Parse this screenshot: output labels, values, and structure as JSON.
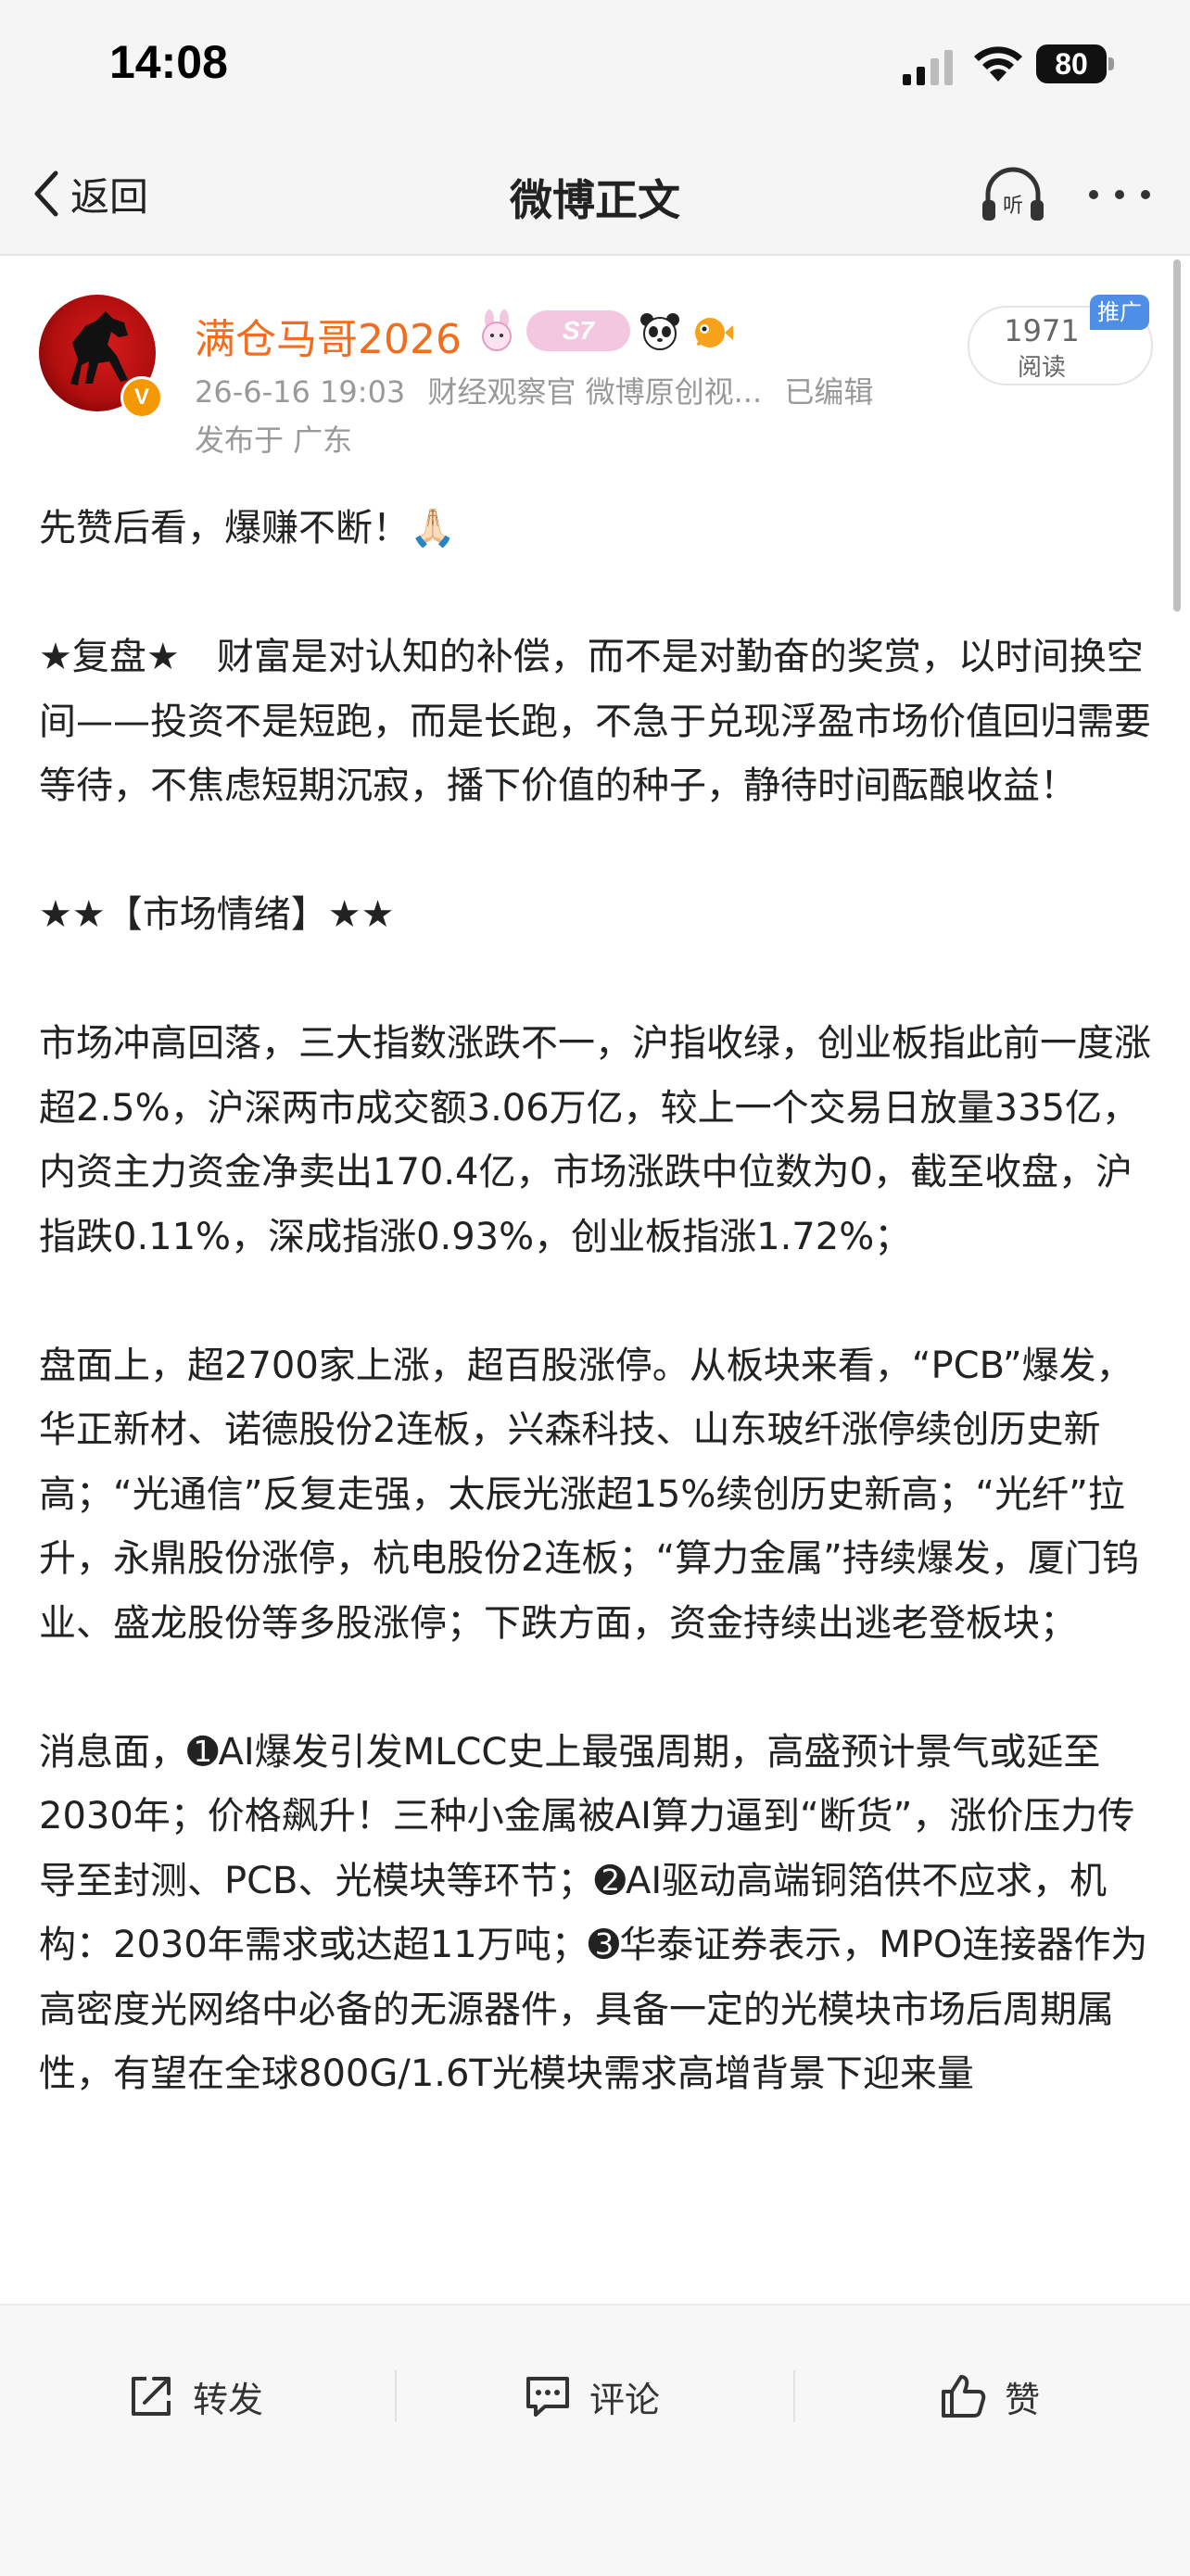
{
  "status_bar": {
    "time": "14:08",
    "battery": "80"
  },
  "nav": {
    "back_label": "返回",
    "title": "微博正文",
    "listen_icon": "headphone-listen-icon",
    "more_icon": "more-dots-icon"
  },
  "post": {
    "author": {
      "name": "满仓马哥2026",
      "member_badge": "S7",
      "verified_color": "#f39800",
      "name_color": "#f26d1e"
    },
    "meta": {
      "datetime": "26-6-16 19:03",
      "source": "财经观察官 微博原创视...",
      "edited": "已编辑",
      "location": "发布于 广东"
    },
    "read": {
      "count": "1971",
      "label": "阅读",
      "promo_tag": "推广"
    },
    "paragraphs": [
      "先赞后看，爆赚不断！🙏🏻",
      "",
      "★复盘★　财富是对认知的补偿，而不是对勤奋的奖赏，以时间换空间——投资不是短跑，而是长跑，不急于兑现浮盈市场价值回归需要等待，不焦虑短期沉寂，播下价值的种子，静待时间酝酿收益！",
      "",
      "★★【市场情绪】★★",
      "",
      "市场冲高回落，三大指数涨跌不一，沪指收绿，创业板指此前一度涨超2.5%，沪深两市成交额3.06万亿，较上一个交易日放量335亿，内资主力资金净卖出170.4亿，市场涨跌中位数为0，截至收盘，沪指跌0.11%，深成指涨0.93%，创业板指涨1.72%；",
      "",
      "盘面上，超2700家上涨，超百股涨停。从板块来看，“PCB”爆发，华正新材、诺德股份2连板，兴森科技、山东玻纤涨停续创历史新高；“光通信”反复走强，太辰光涨超15%续创历史新高；“光纤”拉升，永鼎股份涨停，杭电股份2连板；“算力金属”持续爆发，厦门钨业、盛龙股份等多股涨停；下跌方面，资金持续出逃老登板块；",
      "",
      "消息面，➊AI爆发引发MLCC史上最强周期，高盛预计景气或延至2030年；价格飙升！三种小金属被AI算力逼到“断货”，涨价压力传导至封测、PCB、光模块等环节；➋AI驱动高端铜箔供不应求，机构：2030年需求或达超11万吨；➌华泰证券表示，MPO连接器作为高密度光网络中必备的无源器件，具备一定的光模块市场后周期属性，有望在全球800G/1.6T光模块需求高增背景下迎来量"
    ]
  },
  "actions": {
    "repost": "转发",
    "comment": "评论",
    "like": "赞"
  }
}
